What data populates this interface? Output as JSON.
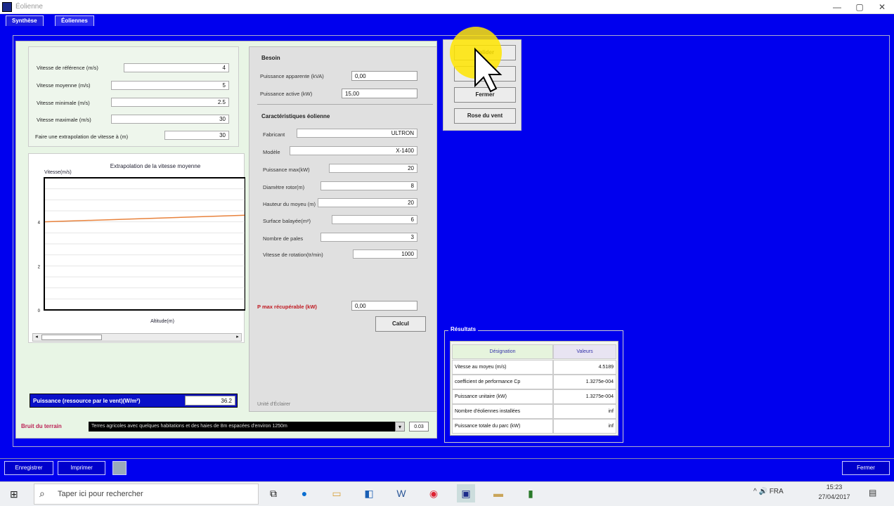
{
  "window": {
    "title": "Éolienne",
    "minimize": "—",
    "maximize": "▢",
    "close": "✕"
  },
  "tabs": [
    {
      "label": "Synthèse"
    },
    {
      "label": "Éoliennes"
    }
  ],
  "params": [
    {
      "label": "Vitesse de référence (m/s)",
      "value": "4"
    },
    {
      "label": "Vitesse moyenne (m/s)",
      "value": "5"
    },
    {
      "label": "Vitesse minimale (m/s)",
      "value": "2.5"
    },
    {
      "label": "Vitesse maximale (m/s)",
      "value": "30"
    },
    {
      "label": "Faire une extrapolation de vitesse à (m)",
      "value": "30"
    }
  ],
  "chart_data": {
    "type": "line",
    "title": "Extrapolation de la vitesse moyenne",
    "ylabel": "Vitesse(m/s)",
    "xlabel": "Altitude(m)",
    "y_ticks": [
      "4",
      "2",
      "0"
    ],
    "ylim": [
      0,
      6
    ],
    "x": [
      0,
      100
    ],
    "series": [
      {
        "values": [
          4,
          4.3
        ],
        "color": "#e8823c"
      }
    ]
  },
  "pump": {
    "besoin_title": "Besoin",
    "puissance_apparente": {
      "label": "Puissance apparente (kVA)",
      "value": "0,00"
    },
    "puissance_active": {
      "label": "Puissance active (kW)",
      "value": "15,00"
    },
    "caracteristiques_title": "Caractéristiques éolienne",
    "fields": [
      {
        "label": "Fabricant",
        "value": "ULTRON"
      },
      {
        "label": "Modèle",
        "value": "X-1400"
      },
      {
        "label": "Puissance max(kW)",
        "value": "20"
      },
      {
        "label": "Diamètre rotor(m)",
        "value": "8"
      },
      {
        "label": "Hauteur du moyeu (m)",
        "value": "20"
      },
      {
        "label": "Surface balayée(m²)",
        "value": "6"
      },
      {
        "label": "Nombre de pales",
        "value": "3"
      },
      {
        "label": "Vitesse de rotation(tr/min)",
        "value": "1000"
      }
    ],
    "recuperable": {
      "label": "P max récupérable (kW)",
      "value": "0,00"
    },
    "calcul_button": "Calcul",
    "footer_text": "Unité d'Éclairer"
  },
  "puissance_bar": {
    "label": "Puissance (ressource par le vent)(W/m²)",
    "value": "36.2"
  },
  "bruit": {
    "label": "Bruit du terrain",
    "combo": "Terres agricoles avec quelques habitations et des haies de 8m espacées d'environ 1250m",
    "value": "0.03"
  },
  "right_buttons": [
    {
      "label": "Valider"
    },
    {
      "label": "Effacer"
    },
    {
      "label": "Fermer"
    },
    {
      "label": "Rose du vent"
    }
  ],
  "results": {
    "title": "Résultats",
    "headers": [
      "Désignation",
      "Valeurs"
    ],
    "rows": [
      {
        "label": "Vitesse au moyeu (m/s)",
        "value": "4.5189"
      },
      {
        "label": "coefficient de performance Cp",
        "value": "1.3275e-004"
      },
      {
        "label": "Puissance unitaire (kW)",
        "value": "1.3275e-004"
      },
      {
        "label": "Nombre d'éoliennes installées",
        "value": "inf"
      },
      {
        "label": "Puissance totale du parc (kW)",
        "value": "inf"
      }
    ]
  },
  "bottom_buttons": {
    "enregistrer": "Enregistrer",
    "imprimer": "Imprimer",
    "fermer": "Fermer"
  },
  "taskbar": {
    "search_placeholder": "Taper ici pour rechercher",
    "time": "15:23",
    "date": "27/04/2017",
    "tray": "^ 🔊 FRA"
  }
}
